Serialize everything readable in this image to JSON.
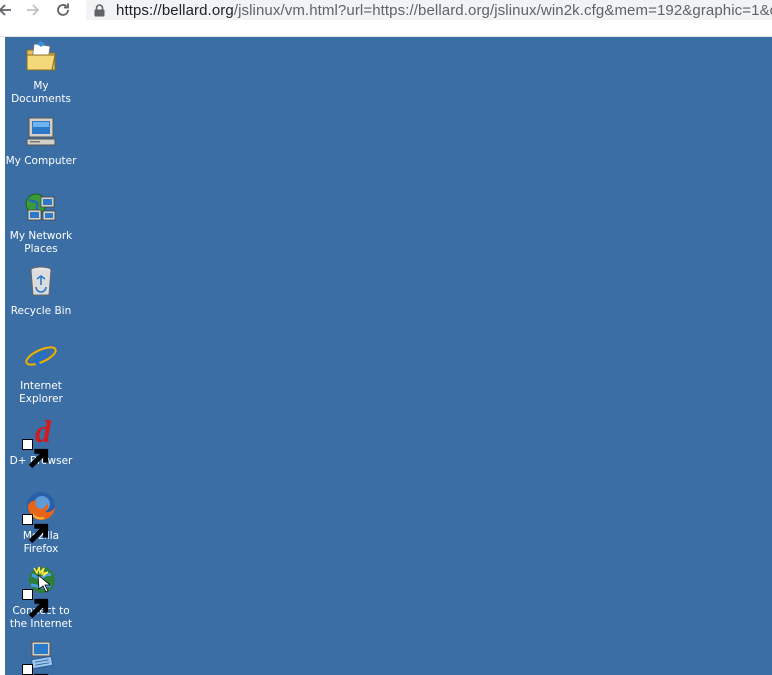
{
  "browser": {
    "url_host": "https://bellard.org",
    "url_rest": "/jslinux/vm.html?url=https://bellard.org/jslinux/win2k.cfg&mem=192&graphic=1&c"
  },
  "desktop": {
    "background_color": "#3a6ea5",
    "icons": [
      {
        "label": "My Documents",
        "icon": "my-documents-icon",
        "shortcut": false
      },
      {
        "label": "My Computer",
        "icon": "my-computer-icon",
        "shortcut": false
      },
      {
        "label": "My Network Places",
        "icon": "my-network-places-icon",
        "shortcut": false
      },
      {
        "label": "Recycle Bin",
        "icon": "recycle-bin-icon",
        "shortcut": false
      },
      {
        "label": "Internet Explorer",
        "icon": "internet-explorer-icon",
        "shortcut": false
      },
      {
        "label": "D+ Browser",
        "icon": "d-plus-browser-icon",
        "shortcut": true
      },
      {
        "label": "Mozilla Firefox",
        "icon": "firefox-icon",
        "shortcut": true
      },
      {
        "label": "Connect to the Internet",
        "icon": "connect-internet-icon",
        "shortcut": true
      },
      {
        "label": "",
        "icon": "keyboard-app-icon",
        "shortcut": true
      }
    ]
  }
}
